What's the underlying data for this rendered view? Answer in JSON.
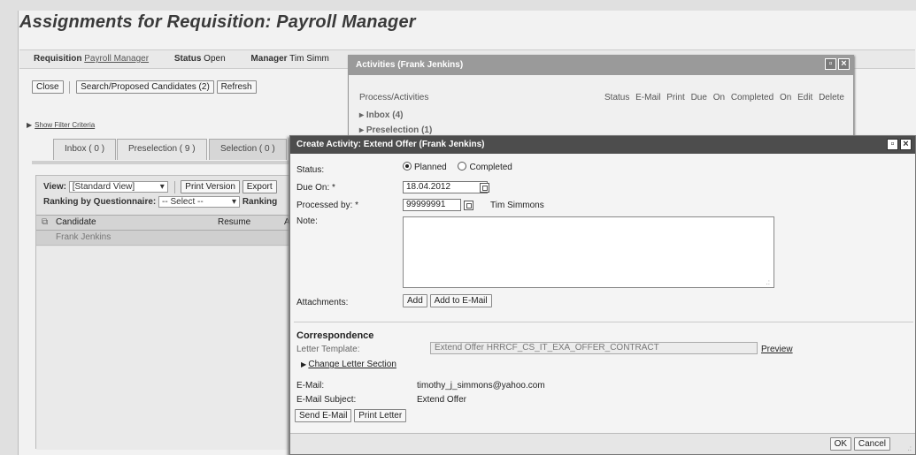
{
  "page": {
    "title": "Assignments for Requisition: Payroll Manager",
    "requisition": {
      "label": "Requisition",
      "value": "Payroll Manager"
    },
    "status": {
      "label": "Status",
      "value": "Open"
    },
    "manager": {
      "label": "Manager",
      "value": "Tim Simm"
    },
    "toolbar": {
      "close": "Close",
      "search": "Search/Proposed Candidates (2)",
      "refresh": "Refresh"
    },
    "filter": "Show Filter Criteria",
    "tabs": [
      "Inbox ( 0 )",
      "Preselection ( 9 )",
      "Selection ( 0 )"
    ],
    "view": {
      "label": "View:",
      "value": "[Standard View]",
      "print": "Print Version",
      "export": "Export"
    },
    "ranking": {
      "label": "Ranking by Questionnaire:",
      "value": "-- Select --",
      "label2": "Ranking"
    },
    "grid": {
      "headers": [
        "Candidate",
        "Resume",
        "A"
      ],
      "rows": [
        [
          "Frank Jenkins"
        ]
      ]
    }
  },
  "activities": {
    "title": "Activities (Frank Jenkins)",
    "col_process": "Process/Activities",
    "cols_right": "Status  E-Mail  Print  Due On  Completed On  Edit  Delete",
    "rows": [
      "Inbox (4)",
      "Preselection (1)"
    ]
  },
  "create": {
    "title": "Create Activity: Extend Offer (Frank Jenkins)",
    "status_label": "Status:",
    "planned": "Planned",
    "completed": "Completed",
    "dueon_label": "Due On: *",
    "dueon_value": "18.04.2012",
    "processed_label": "Processed by: *",
    "processed_value": "99999991",
    "processed_name": "Tim Simmons",
    "note_label": "Note:",
    "attach_label": "Attachments:",
    "add": "Add",
    "add_email": "Add to E-Mail",
    "corr_heading": "Correspondence",
    "letter_label": "Letter Template:",
    "letter_value": "Extend Offer HRRCF_CS_IT_EXA_OFFER_CONTRACT",
    "preview": "Preview",
    "change_letter": "Change Letter Section",
    "email_label": "E-Mail:",
    "email_value": "timothy_j_simmons@yahoo.com",
    "subject_label": "E-Mail Subject:",
    "subject_value": "Extend Offer",
    "send_email": "Send E-Mail",
    "print_letter": "Print Letter",
    "ok": "OK",
    "cancel": "Cancel"
  }
}
